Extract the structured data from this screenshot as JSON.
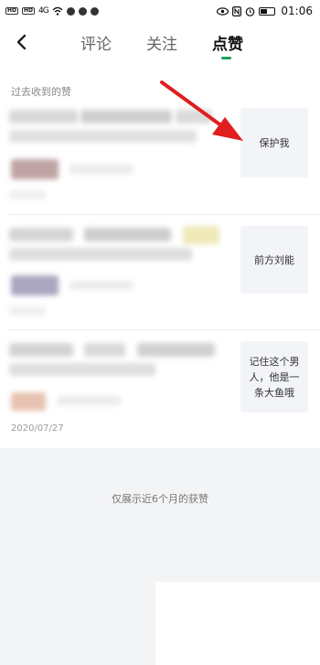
{
  "status_bar": {
    "network_1": "HD",
    "network_2": "HD",
    "signal_text": "4G",
    "time": "01:06",
    "battery_level": 0.5
  },
  "nav": {
    "tabs": [
      {
        "label": "评论",
        "active": false
      },
      {
        "label": "关注",
        "active": false
      },
      {
        "label": "点赞",
        "active": true
      }
    ]
  },
  "section_label": "过去收到的赞",
  "items": [
    {
      "content_text": "保护我"
    },
    {
      "content_text": "前方刘能"
    },
    {
      "content_text": "记住这个男人，他是一条大鱼哦"
    }
  ],
  "date_visible": "2020/07/27",
  "footer_text": "仅展示近6个月的获赞",
  "colors": {
    "accent": "#1aa15c",
    "arrow": "#e01e1e",
    "thumb_bg": "#f2f4f7",
    "footer_bg": "#f3f4f6"
  },
  "icons": [
    "back-arrow-icon",
    "wifi-icon",
    "eye-icon",
    "nfc-icon",
    "alarm-icon",
    "battery-icon"
  ]
}
